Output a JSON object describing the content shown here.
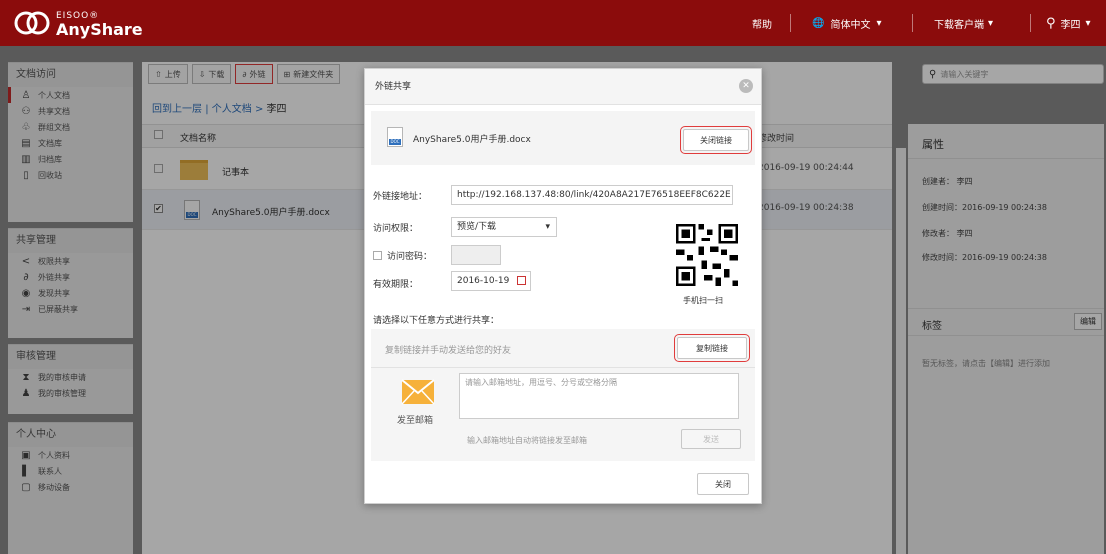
{
  "header": {
    "logo_small": "EISOO®",
    "logo_main": "AnyShare",
    "help": "帮助",
    "language": "简体中文",
    "download_client": "下载客户端",
    "user": "李四"
  },
  "sidebar": {
    "sections": [
      {
        "title": "文档访问",
        "items": [
          {
            "label": "个人文档",
            "icon": "user-icon",
            "active": true
          },
          {
            "label": "共享文档",
            "icon": "users-icon"
          },
          {
            "label": "群组文档",
            "icon": "group-icon"
          },
          {
            "label": "文档库",
            "icon": "library-icon"
          },
          {
            "label": "归档库",
            "icon": "archive-icon"
          },
          {
            "label": "回收站",
            "icon": "trash-icon"
          }
        ]
      },
      {
        "title": "共享管理",
        "items": [
          {
            "label": "权限共享",
            "icon": "share-icon"
          },
          {
            "label": "外链共享",
            "icon": "link-icon"
          },
          {
            "label": "发现共享",
            "icon": "eye-icon"
          },
          {
            "label": "已屏蔽共享",
            "icon": "blocked-icon"
          }
        ]
      },
      {
        "title": "审核管理",
        "items": [
          {
            "label": "我的审核申请",
            "icon": "hourglass-icon"
          },
          {
            "label": "我的审核管理",
            "icon": "reviewer-icon"
          }
        ]
      },
      {
        "title": "个人中心",
        "items": [
          {
            "label": "个人资料",
            "icon": "profile-icon"
          },
          {
            "label": "联系人",
            "icon": "contacts-icon"
          },
          {
            "label": "移动设备",
            "icon": "device-icon"
          }
        ]
      }
    ]
  },
  "toolbar": {
    "upload": "上传",
    "download": "下载",
    "link": "外链",
    "new_folder": "新建文件夹"
  },
  "breadcrumb": {
    "back": "回到上一层",
    "sep": "|",
    "path1": "个人文档",
    "arrow": ">",
    "path2": "李四"
  },
  "list": {
    "col_name": "文档名称",
    "col_modified": "修改时间",
    "rows": [
      {
        "name": "记事本",
        "modified": "2016-09-19 00:24:44",
        "checked": false,
        "type": "folder"
      },
      {
        "name": "AnyShare5.0用户手册.docx",
        "modified": "2016-09-19 00:24:38",
        "checked": true,
        "type": "docx"
      }
    ]
  },
  "search": {
    "placeholder": "请输入关键字"
  },
  "properties": {
    "title": "属性",
    "creator_label": "创建者：",
    "creator": "李四",
    "created_label": "创建时间：",
    "created": "2016-09-19 00:24:38",
    "modifier_label": "修改者：",
    "modifier": "李四",
    "modified_label": "修改时间：",
    "modified": "2016-09-19 00:24:38",
    "tags_title": "标签",
    "tags_edit": "编辑",
    "tags_empty": "暂无标签，请点击【编辑】进行添加"
  },
  "modal": {
    "title": "外链共享",
    "file_name": "AnyShare5.0用户手册.docx",
    "close_link": "关闭链接",
    "link_label": "外链接地址：",
    "link_value": "http://192.168.137.48:80/link/420A8A217E76518EEF8C622E",
    "permission_label": "访问权限：",
    "permission_value": "预览/下载",
    "password_label": "访问密码：",
    "expiry_label": "有效期限：",
    "expiry_value": "2016-10-19",
    "qr_caption": "手机扫一扫",
    "choose_text": "请选择以下任意方式进行共享：",
    "copy_hint": "复制链接并手动发送给您的好友",
    "copy_button": "复制链接",
    "email_placeholder": "请输入邮箱地址，用逗号、分号或空格分隔",
    "email_label": "发至邮箱",
    "email_hint": "输入邮箱地址自动将链接发至邮箱",
    "send_button": "发送",
    "close_button": "关闭"
  }
}
